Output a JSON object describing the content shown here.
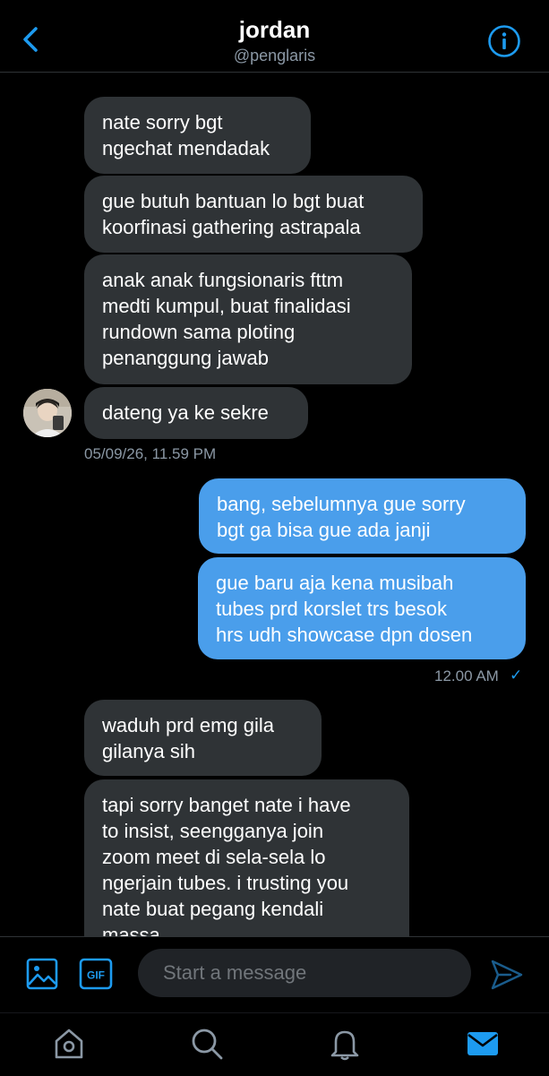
{
  "header": {
    "name": "jordan",
    "handle": "@penglaris"
  },
  "messages": [
    {
      "direction": "in",
      "text": "nate sorry bgt\nngechat mendadak"
    },
    {
      "direction": "in",
      "text": "gue butuh bantuan lo bgt buat\nkoorfinasi gathering astrapala"
    },
    {
      "direction": "in",
      "text": "anak anak fungsionaris fttm\nmedti kumpul, buat finalidasi\nrundown sama ploting\npenanggung jawab"
    },
    {
      "direction": "in",
      "text": "dateng ya ke sekre"
    },
    {
      "direction": "out",
      "text": "bang, sebelumnya gue sorry\nbgt ga bisa gue ada janji"
    },
    {
      "direction": "out",
      "text": "gue baru aja kena musibah\ntubes prd korslet trs besok\nhrs udh showcase dpn dosen"
    },
    {
      "direction": "in",
      "text": "waduh prd emg gila\ngilanya sih"
    },
    {
      "direction": "in",
      "text": "tapi sorry banget nate i have\nto insist, seengganya join\nzoom meet di sela-sela lo\nngerjain tubes. i trusting you\nnate buat pegang kendali\nmassa"
    }
  ],
  "timestamps": {
    "incoming": "05/09/26, 11.59 PM",
    "outgoing": "12.00 AM",
    "outgoing_check": "✓"
  },
  "composer": {
    "placeholder": "Start a message",
    "gif_label": "GIF"
  },
  "colors": {
    "accent": "#1d9bf0",
    "outgoing_bubble": "#4a9eeb",
    "incoming_bubble": "#2f3336",
    "muted_text": "#8b98a5"
  },
  "icons": {
    "back": "chevron-left-icon",
    "info": "info-icon",
    "image": "image-icon",
    "gif": "gif-icon",
    "send": "send-icon",
    "home": "home-icon",
    "search": "search-icon",
    "notifications": "bell-icon",
    "messages": "mail-icon"
  }
}
